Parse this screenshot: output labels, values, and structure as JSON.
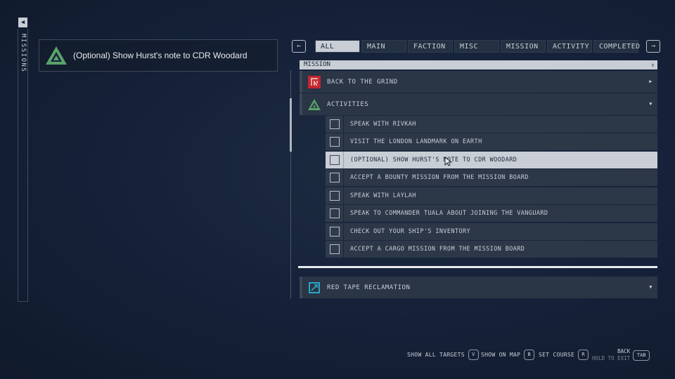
{
  "sidebar": {
    "label": "MISSIONS",
    "back_glyph": "◀"
  },
  "objective_card": {
    "text": "(Optional) Show Hurst's note to CDR Woodard",
    "icon": "activity-triangle-icon"
  },
  "tabs": {
    "prev_glyph": "←",
    "next_glyph": "→",
    "items": [
      {
        "label": "ALL",
        "active": true
      },
      {
        "label": "MAIN"
      },
      {
        "label": "FACTION"
      },
      {
        "label": "MISC"
      },
      {
        "label": "MISSION"
      },
      {
        "label": "ACTIVITY"
      },
      {
        "label": "COMPLETED"
      }
    ]
  },
  "category": {
    "label": "MISSION",
    "glyph": "⇕"
  },
  "missions": {
    "back_to_grind": {
      "label": "BACK TO THE GRIND",
      "icon": "faction-emblem-icon",
      "chevron": "▶"
    },
    "activities": {
      "label": "ACTIVITIES",
      "icon": "activity-triangle-icon",
      "chevron": "▼"
    },
    "red_tape": {
      "label": "RED TAPE RECLAMATION",
      "icon": "mission-square-icon",
      "chevron": "▼"
    }
  },
  "objectives": [
    "SPEAK WITH RIVKAH",
    "VISIT THE LONDON LANDMARK ON EARTH",
    "(OPTIONAL) SHOW HURST'S NOTE TO CDR WOODARD",
    "ACCEPT A BOUNTY MISSION FROM THE MISSION BOARD",
    "SPEAK WITH LAYLAH",
    "SPEAK TO COMMANDER TUALA ABOUT JOINING THE VANGUARD",
    "CHECK OUT YOUR SHIP'S INVENTORY",
    "ACCEPT A CARGO MISSION FROM THE MISSION BOARD"
  ],
  "hints": {
    "show_all_targets": {
      "label": "SHOW ALL TARGETS",
      "key": "V"
    },
    "show_on_map": {
      "label": "SHOW ON MAP",
      "key": "B"
    },
    "set_course": {
      "label": "SET COURSE",
      "key": "R"
    },
    "back": {
      "label": "BACK",
      "sub": "HOLD TO EXIT",
      "key": "TAB"
    }
  },
  "colors": {
    "accent_green": "#5aa36a",
    "faction_red": "#c4262e",
    "mission_cyan": "#2aa6c6",
    "highlight": "#c9ced6"
  }
}
